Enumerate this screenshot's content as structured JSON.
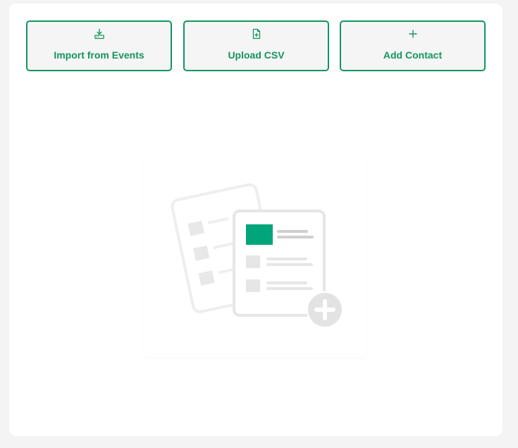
{
  "actions": {
    "import_events": {
      "label": "Import from Events",
      "icon": "download-tray-icon"
    },
    "upload_csv": {
      "label": "Upload CSV",
      "icon": "file-plus-icon"
    },
    "add_contact": {
      "label": "Add Contact",
      "icon": "plus-icon"
    }
  },
  "empty_state": {
    "illustration": "contact-list-add-illustration"
  },
  "colors": {
    "accent": "#14955f",
    "illustration_accent": "#00a67a",
    "illustration_gray": "#e6e6e6",
    "background": "#f4f4f4",
    "card": "#ffffff"
  }
}
